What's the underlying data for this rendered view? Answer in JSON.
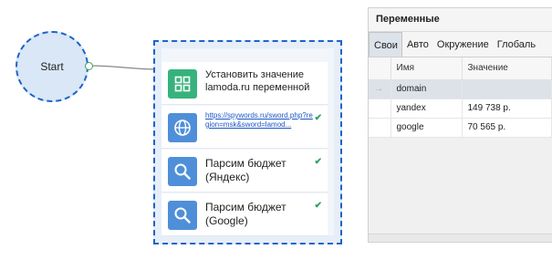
{
  "flow": {
    "start_label": "Start",
    "actions": [
      {
        "kind": "label",
        "icon": "grid-icon",
        "text": "Установить значение lamoda.ru переменной",
        "checked": false
      },
      {
        "kind": "link",
        "icon": "globe-icon",
        "text": "https://spywords.ru/sword.php?region=msk&sword=lamod...",
        "checked": true
      },
      {
        "kind": "label",
        "icon": "search-icon",
        "text": "Парсим бюджет (Яндекс)",
        "checked": true
      },
      {
        "kind": "label",
        "icon": "search-icon",
        "text": "Парсим бюджет (Google)",
        "checked": true
      }
    ],
    "check_glyph": "✔",
    "colors": {
      "accent": "#1f63c9",
      "green": "#37b27d",
      "blue": "#4f8fd9"
    }
  },
  "panel": {
    "title": "Переменные",
    "tabs": [
      "Свои",
      "Авто",
      "Окружение",
      "Глобаль"
    ],
    "active_tab": 0,
    "columns": [
      "Имя",
      "Значение"
    ],
    "rows": [
      {
        "marker": "→",
        "name": "domain",
        "value": ""
      },
      {
        "marker": "",
        "name": "yandex",
        "value": "149 738 р."
      },
      {
        "marker": "",
        "name": "google",
        "value": "70 565 р."
      }
    ],
    "selected_row": 0
  }
}
